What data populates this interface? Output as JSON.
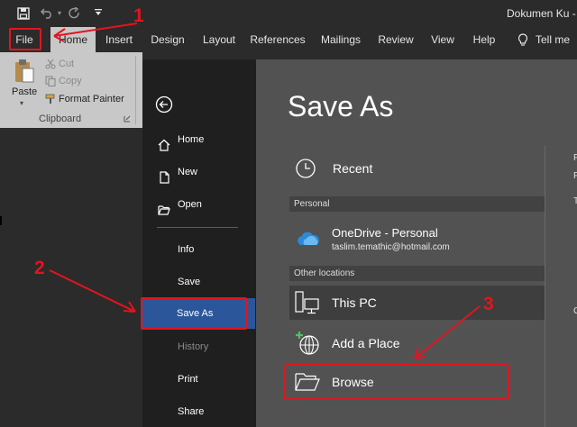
{
  "window": {
    "title": "Dokumen Ku - W"
  },
  "quick_access": {
    "save_icon": "save-icon",
    "undo_icon": "undo-icon",
    "redo_icon": "redo-icon",
    "customize_icon": "customize-icon"
  },
  "ribbon_tabs": [
    "File",
    "Home",
    "Insert",
    "Design",
    "Layout",
    "References",
    "Mailings",
    "Review",
    "View",
    "Help"
  ],
  "tell_me": {
    "label": "Tell me"
  },
  "clipboard": {
    "paste": "Paste",
    "cut": "Cut",
    "copy": "Copy",
    "format_painter": "Format Painter",
    "group_label": "Clipboard"
  },
  "backstage": {
    "nav_top": [
      {
        "label": "Home",
        "icon": "home-icon"
      },
      {
        "label": "New",
        "icon": "new-document-icon"
      },
      {
        "label": "Open",
        "icon": "open-folder-icon"
      }
    ],
    "nav_bottom": [
      {
        "label": "Info",
        "state": "normal"
      },
      {
        "label": "Save",
        "state": "normal"
      },
      {
        "label": "Save As",
        "state": "selected"
      },
      {
        "label": "History",
        "state": "disabled"
      },
      {
        "label": "Print",
        "state": "normal"
      },
      {
        "label": "Share",
        "state": "normal"
      }
    ]
  },
  "save_as": {
    "title": "Save As",
    "recent": "Recent",
    "personal_header": "Personal",
    "onedrive": {
      "name": "OneDrive - Personal",
      "email": "taslim.temathic@hotmail.com"
    },
    "other_header": "Other locations",
    "this_pc": "This PC",
    "add_place": "Add a Place",
    "browse": "Browse",
    "right_edge": [
      "P",
      "P",
      "T",
      "C"
    ]
  },
  "annotations": {
    "step1": "1",
    "step2": "2",
    "step3": "3",
    "color": "#e3141e"
  }
}
